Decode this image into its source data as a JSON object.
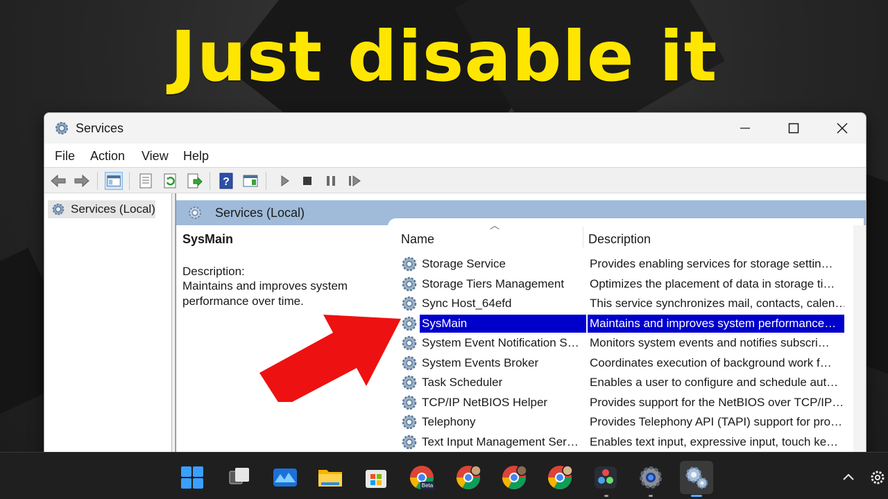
{
  "overlay": {
    "headline": "Just disable it"
  },
  "window": {
    "title": "Services",
    "controls": {
      "minimize": "minimize",
      "maximize": "maximize",
      "close": "close"
    }
  },
  "menu": {
    "items": [
      "File",
      "Action",
      "View",
      "Help"
    ]
  },
  "left_pane": {
    "tree_item": "Services (Local)"
  },
  "right_pane": {
    "header": "Services (Local)",
    "selected_service": {
      "name": "SysMain",
      "description_label": "Description:",
      "description": "Maintains and improves system performance over time."
    },
    "columns": {
      "name": "Name",
      "description": "Description"
    },
    "rows": [
      {
        "name": "Storage Service",
        "description": "Provides enabling services for storage settin…"
      },
      {
        "name": "Storage Tiers Management",
        "description": "Optimizes the placement of data in storage ti…"
      },
      {
        "name": "Sync Host_64efd",
        "description": "This service synchronizes mail, contacts, calen…"
      },
      {
        "name": "SysMain",
        "description": "Maintains and improves system performance…",
        "selected": true
      },
      {
        "name": "System Event Notification S…",
        "description": "Monitors system events and notifies subscri…"
      },
      {
        "name": "System Events Broker",
        "description": "Coordinates execution of background work f…"
      },
      {
        "name": "Task Scheduler",
        "description": "Enables a user to configure and schedule aut…"
      },
      {
        "name": "TCP/IP NetBIOS Helper",
        "description": "Provides support for the NetBIOS over TCP/IP…"
      },
      {
        "name": "Telephony",
        "description": "Provides Telephony API (TAPI) support for pro…"
      },
      {
        "name": "Text Input Management Ser…",
        "description": "Enables text input, expressive input, touch ke…"
      }
    ]
  },
  "colors": {
    "headline": "#ffe600",
    "selection": "#0000cc",
    "header_band": "#9fbbd9",
    "arrow": "#ee1111"
  },
  "taskbar": {
    "icons": [
      "windows-start-icon",
      "task-view-icon",
      "widgets-icon",
      "file-explorer-icon",
      "microsoft-store-icon",
      "chrome-beta-icon",
      "chrome-profile-icon",
      "chrome-profile-icon",
      "chrome-profile-icon",
      "davinci-resolve-icon",
      "settings-icon",
      "services-icon"
    ],
    "beta_label": "Beta"
  }
}
